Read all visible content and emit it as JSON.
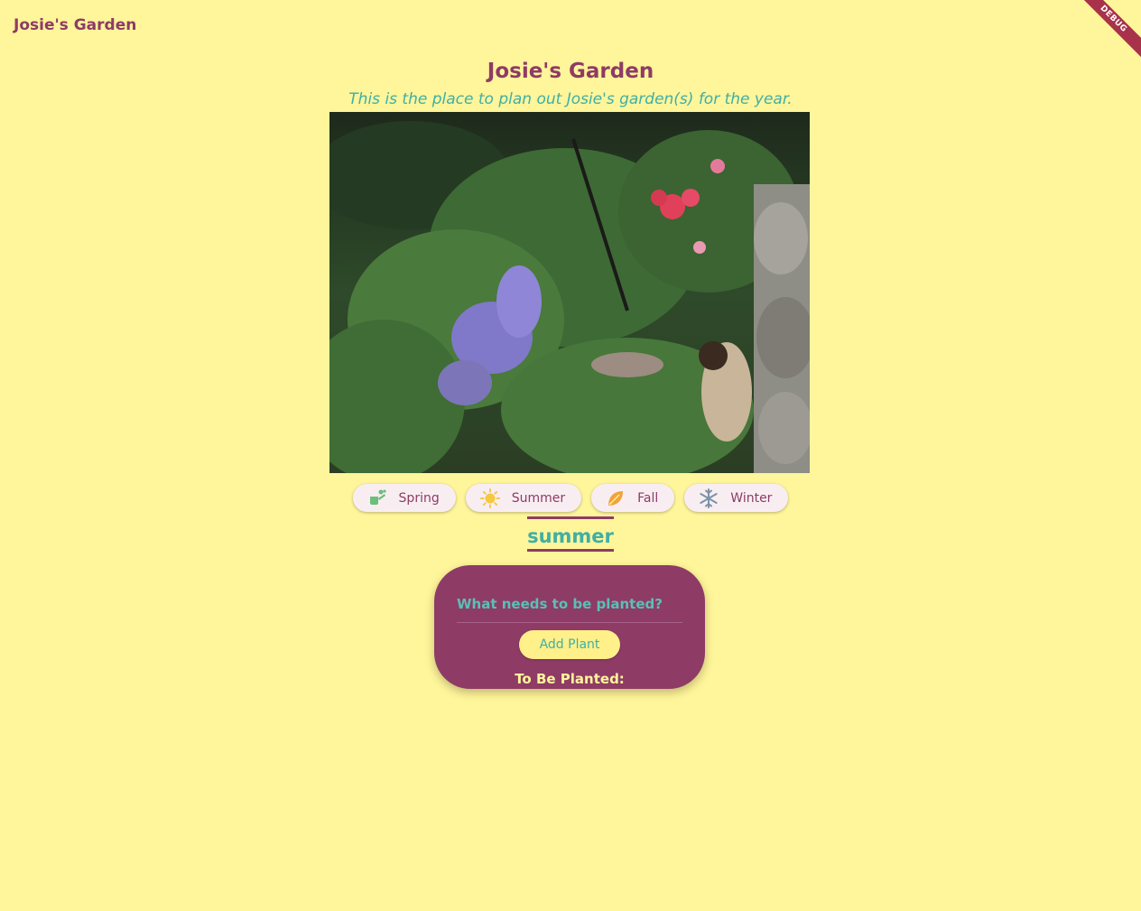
{
  "app_bar": {
    "title": "Josie's Garden"
  },
  "debug_banner": {
    "label": "DEBUG"
  },
  "header": {
    "title": "Josie's Garden",
    "subtitle": "This is the place to plan out Josie's garden(s) for the year."
  },
  "seasons": [
    {
      "label": "Spring",
      "icon": "watering-can-icon",
      "color": "#6DBE7A"
    },
    {
      "label": "Summer",
      "icon": "sun-icon",
      "color": "#F5C842"
    },
    {
      "label": "Fall",
      "icon": "leaf-icon",
      "color": "#F2A33A"
    },
    {
      "label": "Winter",
      "icon": "snowflake-icon",
      "color": "#7A93A8"
    }
  ],
  "selected_season": "summer",
  "plant_form": {
    "placeholder": "What needs to be planted?",
    "add_button": "Add Plant",
    "list_heading": "To Be Planted:"
  },
  "colors": {
    "background": "#FFF59A",
    "primary": "#8E3B66",
    "accent": "#3FAFA6"
  }
}
